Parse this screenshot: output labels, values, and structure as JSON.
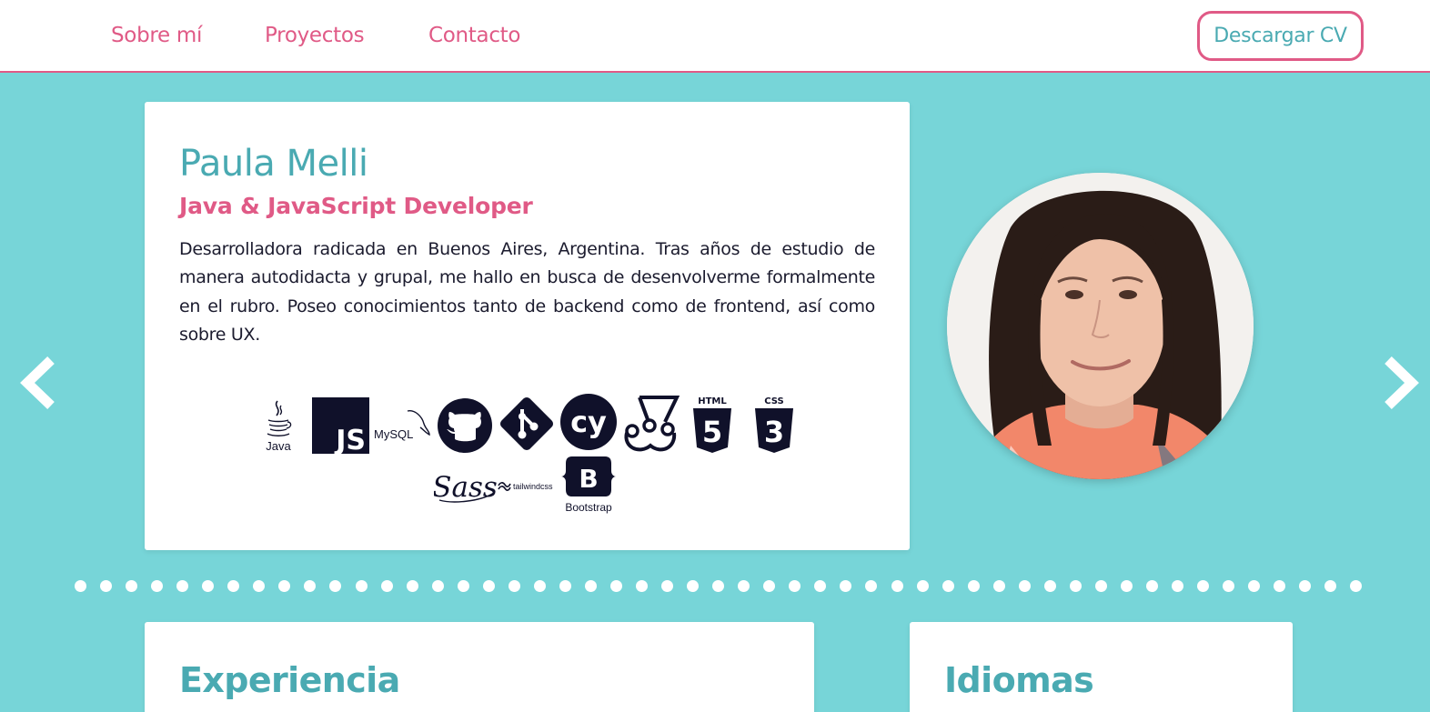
{
  "nav": {
    "links": [
      "Sobre mí",
      "Proyectos",
      "Contacto"
    ],
    "cv_button": "Descargar CV"
  },
  "profile": {
    "name": "Paula Melli",
    "role": "Java & JavaScript Developer",
    "bio": "Desarrolladora radicada en Buenos Aires, Argentina. Tras años de estudio de manera autodidacta y grupal, me hallo en busca de desenvolverme formalmente en el rubro. Poseo conocimientos tanto de backend como de frontend, así como sobre UX."
  },
  "tech_logos": {
    "java": "Java",
    "js": "JS",
    "mysql": "MySQL",
    "cypress": "cy",
    "html": "HTML",
    "html_num": "5",
    "css": "CSS",
    "css_num": "3",
    "sass": "Sass",
    "tailwind": "tailwindcss",
    "bootstrap": "B",
    "bootstrap_label": "Bootstrap"
  },
  "carousel": {
    "dot_count": 51
  },
  "sections": {
    "experience": "Experiencia",
    "languages": "Idiomas"
  },
  "colors": {
    "background": "#77d5d8",
    "accent_pink": "#e05a86",
    "accent_teal": "#4aaab2",
    "logo_dark": "#10112a"
  }
}
